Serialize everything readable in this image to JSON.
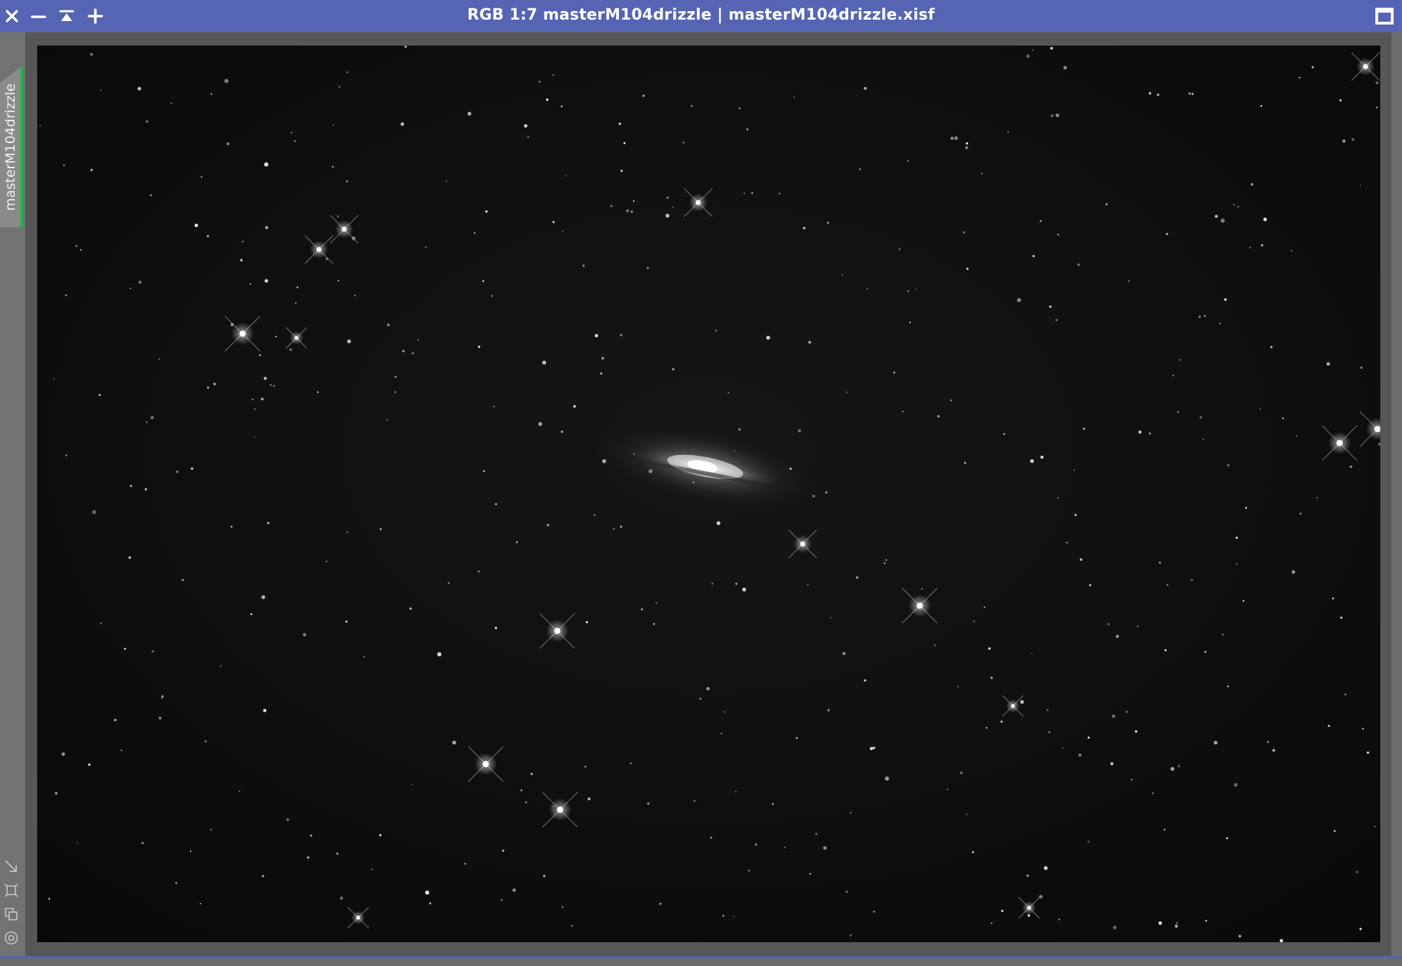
{
  "window": {
    "title": "RGB 1:7 masterM104drizzle | masterM104drizzle.xisf",
    "titlebar_color": "#5565b3",
    "active_tab_color": "#22b14c"
  },
  "titlebar_buttons": [
    {
      "name": "close",
      "icon": "close-icon"
    },
    {
      "name": "minimize",
      "icon": "minimize-icon"
    },
    {
      "name": "shade",
      "icon": "shade-icon"
    },
    {
      "name": "zoom-in",
      "icon": "plus-icon"
    },
    {
      "name": "maximize",
      "icon": "maximize-icon"
    }
  ],
  "view_tab": {
    "label": "masterM104drizzle"
  },
  "side_tools": [
    {
      "name": "resize",
      "icon": "resize-icon"
    },
    {
      "name": "fit-view",
      "icon": "fit-view-icon"
    },
    {
      "name": "clone-view",
      "icon": "clone-icon"
    },
    {
      "name": "preview-target",
      "icon": "target-icon"
    }
  ],
  "image": {
    "subject": "galaxy-m104"
  }
}
